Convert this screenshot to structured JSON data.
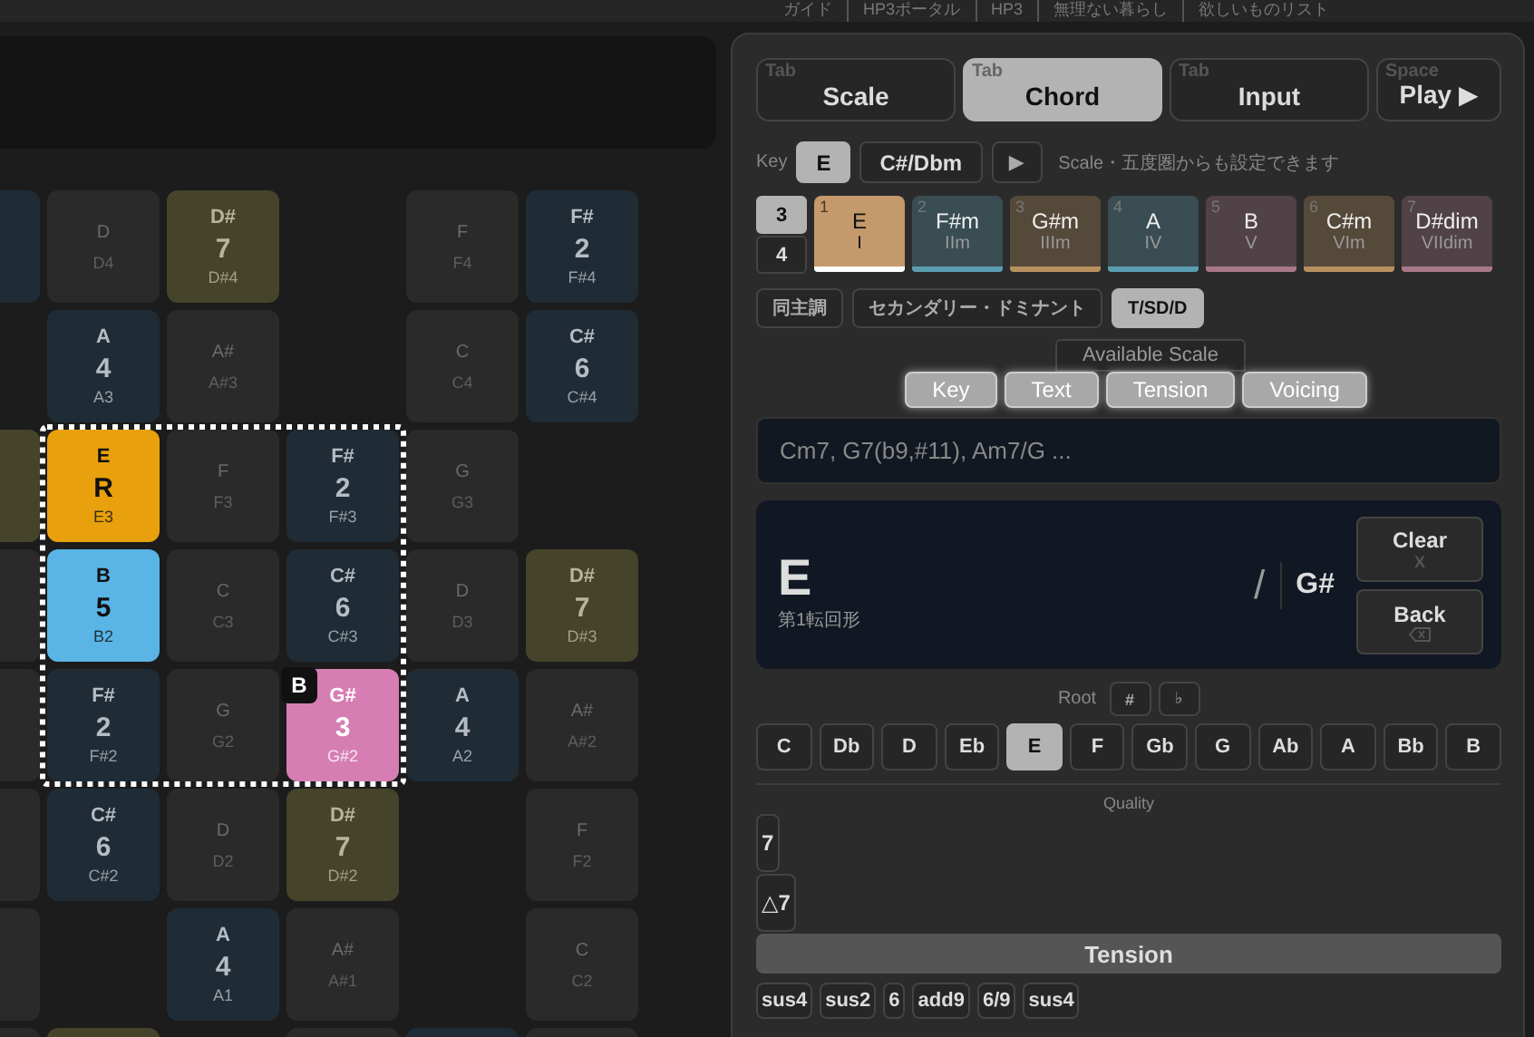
{
  "top_nav": [
    "ガイド",
    "HP3ポータル",
    "HP3",
    "無理ない暮らし",
    "欲しいものリスト"
  ],
  "pad": {
    "selection_badge": "B",
    "rows": [
      [
        {
          "kind": "scale"
        },
        {
          "kind": "off",
          "note": "D",
          "octave": "D4"
        },
        {
          "kind": "seventh",
          "note": "D#",
          "degree": "7",
          "octave": "D#4"
        },
        {
          "kind": "empty"
        },
        {
          "kind": "off",
          "note": "F",
          "octave": "F4"
        },
        {
          "kind": "scale",
          "note": "F#",
          "degree": "2",
          "octave": "F#4"
        }
      ],
      [
        {
          "kind": "empty"
        },
        {
          "kind": "scale",
          "note": "A",
          "degree": "4",
          "octave": "A3"
        },
        {
          "kind": "off",
          "note": "A#",
          "octave": "A#3"
        },
        {
          "kind": "empty"
        },
        {
          "kind": "off",
          "note": "C",
          "octave": "C4"
        },
        {
          "kind": "scale",
          "note": "C#",
          "degree": "6",
          "octave": "C#4"
        }
      ],
      [
        {
          "kind": "seventh"
        },
        {
          "kind": "root",
          "note": "E",
          "degree": "R",
          "octave": "E3"
        },
        {
          "kind": "off",
          "note": "F",
          "octave": "F3"
        },
        {
          "kind": "scale",
          "note": "F#",
          "degree": "2",
          "octave": "F#3"
        },
        {
          "kind": "off",
          "note": "G",
          "octave": "G3"
        },
        {
          "kind": "empty"
        }
      ],
      [
        {
          "kind": "off"
        },
        {
          "kind": "fifth",
          "note": "B",
          "degree": "5",
          "octave": "B2"
        },
        {
          "kind": "off",
          "note": "C",
          "octave": "C3"
        },
        {
          "kind": "scale",
          "note": "C#",
          "degree": "6",
          "octave": "C#3"
        },
        {
          "kind": "off",
          "note": "D",
          "octave": "D3"
        },
        {
          "kind": "seventh",
          "note": "D#",
          "degree": "7",
          "octave": "D#3"
        }
      ],
      [
        {
          "kind": "off"
        },
        {
          "kind": "scale",
          "note": "F#",
          "degree": "2",
          "octave": "F#2"
        },
        {
          "kind": "off",
          "note": "G",
          "octave": "G2"
        },
        {
          "kind": "third",
          "note": "G#",
          "degree": "3",
          "octave": "G#2",
          "badge": true
        },
        {
          "kind": "scale",
          "note": "A",
          "degree": "4",
          "octave": "A2"
        },
        {
          "kind": "off",
          "note": "A#",
          "octave": "A#2"
        }
      ],
      [
        {
          "kind": "off"
        },
        {
          "kind": "scale",
          "note": "C#",
          "degree": "6",
          "octave": "C#2"
        },
        {
          "kind": "off",
          "note": "D",
          "octave": "D2"
        },
        {
          "kind": "seventh",
          "note": "D#",
          "degree": "7",
          "octave": "D#2"
        },
        {
          "kind": "empty"
        },
        {
          "kind": "off",
          "note": "F",
          "octave": "F2"
        }
      ],
      [
        {
          "kind": "off"
        },
        {
          "kind": "empty"
        },
        {
          "kind": "scale",
          "note": "A",
          "degree": "4",
          "octave": "A1"
        },
        {
          "kind": "off",
          "note": "A#",
          "octave": "A#1"
        },
        {
          "kind": "empty"
        },
        {
          "kind": "off",
          "note": "C",
          "octave": "C2"
        }
      ],
      [
        {
          "kind": "off"
        },
        {
          "kind": "seventh"
        },
        {
          "kind": "empty"
        },
        {
          "kind": "off"
        },
        {
          "kind": "scale"
        },
        {
          "kind": "off"
        }
      ]
    ]
  },
  "mode_tabs": [
    {
      "hint": "Tab",
      "label": "Scale",
      "selected": false
    },
    {
      "hint": "Tab",
      "label": "Chord",
      "selected": true
    },
    {
      "hint": "Tab",
      "label": "Input",
      "selected": false
    },
    {
      "hint": "Space",
      "label": "Play ▶",
      "selected": false
    }
  ],
  "key": {
    "label": "Key",
    "options": [
      {
        "label": "E",
        "selected": true
      },
      {
        "label": "C#/Dbm",
        "selected": false
      }
    ],
    "play": "▶",
    "hint": "Scale・五度圏からも設定できます"
  },
  "voices": [
    {
      "label": "3",
      "selected": true
    },
    {
      "label": "4",
      "selected": false
    }
  ],
  "diatonic_chords": [
    {
      "number": "1",
      "name": "E",
      "roman": "I",
      "color": "#c49a6c",
      "selected": true
    },
    {
      "number": "2",
      "name": "F#m",
      "roman": "IIm",
      "color": "#5b9db0",
      "selected": false
    },
    {
      "number": "3",
      "name": "G#m",
      "roman": "IIIm",
      "color": "#b8905e",
      "selected": false
    },
    {
      "number": "4",
      "name": "A",
      "roman": "IV",
      "color": "#5b9db0",
      "selected": false
    },
    {
      "number": "5",
      "name": "B",
      "roman": "V",
      "color": "#a87888",
      "selected": false
    },
    {
      "number": "6",
      "name": "C#m",
      "roman": "VIm",
      "color": "#b8905e",
      "selected": false
    },
    {
      "number": "7",
      "name": "D#dim",
      "roman": "VIIdim",
      "color": "#a87888",
      "selected": false
    }
  ],
  "chord_options": [
    {
      "label": "同主調",
      "selected": false
    },
    {
      "label": "セカンダリー・ドミナント",
      "selected": false
    },
    {
      "label": "T/SD/D",
      "selected": true
    }
  ],
  "available_scale": "Available Scale",
  "sub_tabs": [
    "Key",
    "Text",
    "Tension",
    "Voicing"
  ],
  "chord_input": {
    "placeholder": "Cm7, G7(b9,#11), Am7/G ..."
  },
  "chord_display": {
    "chord": "E",
    "inversion": "第1転回形",
    "slash": "/",
    "bass": "G#",
    "buttons": [
      {
        "label": "Clear",
        "hint": "X",
        "kind": "text"
      },
      {
        "label": "Back",
        "kind": "backspace"
      }
    ]
  },
  "root": {
    "label": "Root",
    "accidentals": [
      "#",
      "♭"
    ],
    "notes": [
      {
        "label": "C",
        "selected": false
      },
      {
        "label": "Db",
        "selected": false
      },
      {
        "label": "D",
        "selected": false
      },
      {
        "label": "Eb",
        "selected": false
      },
      {
        "label": "E",
        "selected": true
      },
      {
        "label": "F",
        "selected": false
      },
      {
        "label": "Gb",
        "selected": false
      },
      {
        "label": "G",
        "selected": false
      },
      {
        "label": "Ab",
        "selected": false
      },
      {
        "label": "A",
        "selected": false
      },
      {
        "label": "Bb",
        "selected": false
      },
      {
        "label": "B",
        "selected": false
      }
    ]
  },
  "quality": {
    "label": "Quality",
    "options": [
      "7",
      "△7"
    ]
  },
  "tension_button": "Tension",
  "tension_options": [
    "sus4",
    "sus2",
    "6",
    "add9",
    "6/9",
    "sus4"
  ]
}
